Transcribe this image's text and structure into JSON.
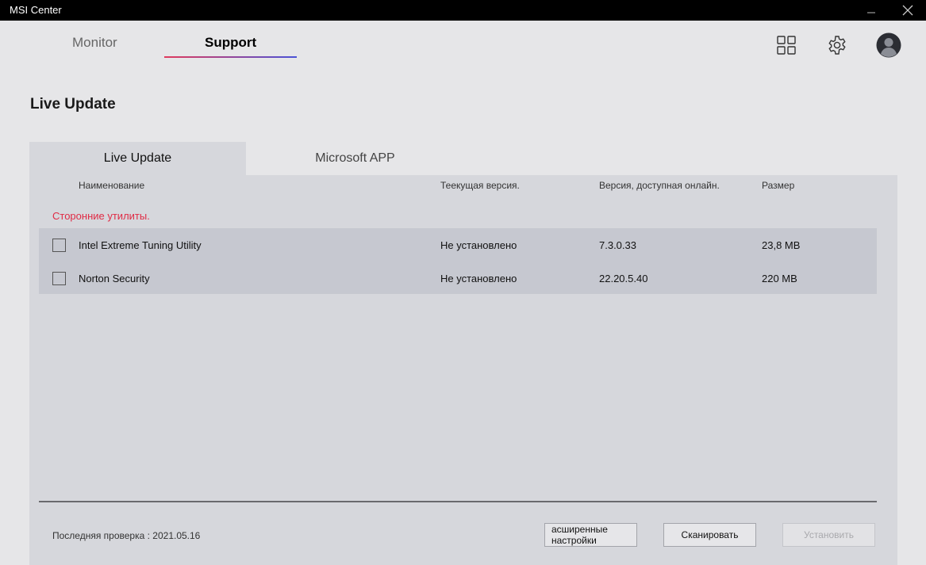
{
  "window": {
    "title": "MSI Center"
  },
  "nav": {
    "monitor": "Monitor",
    "support": "Support"
  },
  "page": {
    "title": "Live Update"
  },
  "tabs": {
    "live_update": "Live Update",
    "microsoft_app": "Microsoft APP"
  },
  "columns": {
    "name": "Наименование",
    "current": "Теекущая версия.",
    "online": "Версия, доступная онлайн.",
    "size": "Размер"
  },
  "section": {
    "label": "Сторонние утилиты."
  },
  "rows": [
    {
      "name": "Intel Extreme Tuning Utility",
      "current": "Не установлено",
      "online": "7.3.0.33",
      "size": "23,8 MB",
      "checked": false
    },
    {
      "name": "Norton Security",
      "current": "Не установлено",
      "online": "22.20.5.40",
      "size": "220 MB",
      "checked": false
    }
  ],
  "footer": {
    "last_check": "Последняя проверка : 2021.05.16",
    "advanced_label": "асширенные настройки",
    "scan_label": "Сканировать",
    "install_label": "Установить"
  },
  "icons": {
    "minimize": "minimize-icon",
    "close": "close-icon",
    "grid": "grid-icon",
    "gear": "gear-icon",
    "avatar": "avatar-icon"
  },
  "colors": {
    "accent_red": "#e02b45",
    "underline_start": "#e03a5c",
    "underline_end": "#4a52d6"
  }
}
